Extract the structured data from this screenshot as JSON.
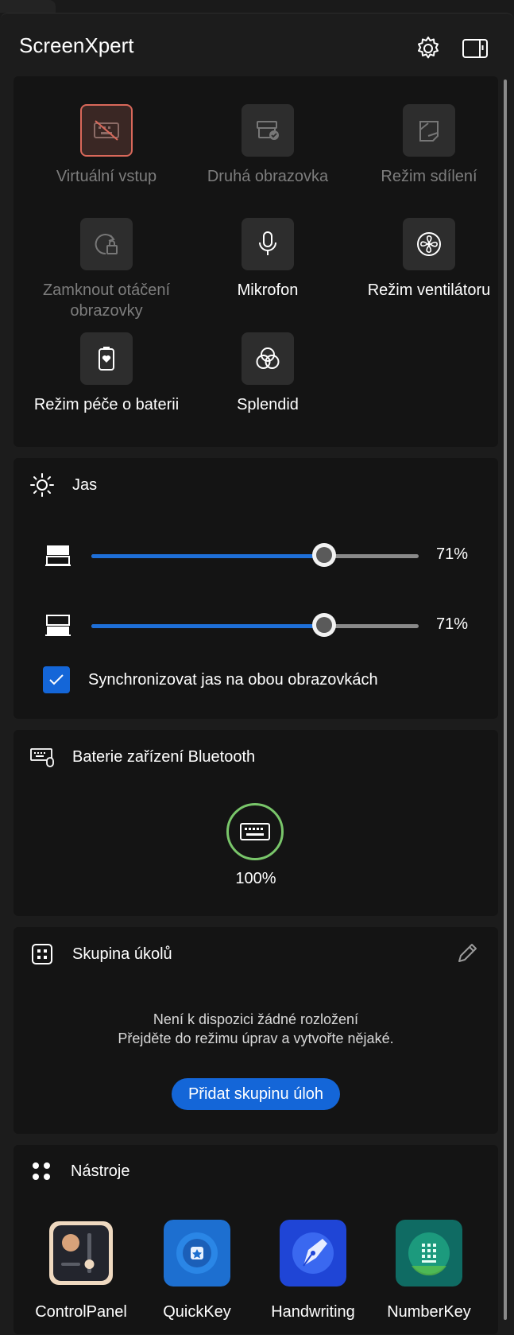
{
  "header": {
    "title": "ScreenXpert",
    "settings_icon": "gear-icon",
    "layout_icon": "panel-layout-icon"
  },
  "quick_tiles": [
    {
      "label": "Virtuální vstup",
      "icon": "keyboard-off-icon",
      "state": "active",
      "enabled": false
    },
    {
      "label": "Druhá obrazovka",
      "icon": "second-screen-icon",
      "enabled": false
    },
    {
      "label": "Režim sdílení",
      "icon": "share-mode-icon",
      "enabled": false
    },
    {
      "label": "Zamknout otáčení obrazovky",
      "icon": "rotation-lock-icon",
      "enabled": false
    },
    {
      "label": "Mikrofon",
      "icon": "microphone-icon",
      "enabled": true
    },
    {
      "label": "Režim ventilátoru",
      "icon": "fan-icon",
      "enabled": true
    },
    {
      "label": "Režim péče o baterii",
      "icon": "battery-care-icon",
      "enabled": true
    },
    {
      "label": "Splendid",
      "icon": "splendid-icon",
      "enabled": true
    }
  ],
  "brightness": {
    "title": "Jas",
    "icon": "sun-icon",
    "sliders": [
      {
        "screen": "top-screen-icon",
        "value": 71,
        "label": "71%"
      },
      {
        "screen": "bottom-screen-icon",
        "value": 71,
        "label": "71%"
      }
    ],
    "sync": {
      "label": "Synchronizovat jas na obou obrazovkách",
      "checked": true
    }
  },
  "bluetooth": {
    "title": "Baterie zařízení Bluetooth",
    "icon": "keyboard-mouse-icon",
    "device_icon": "keyboard-icon",
    "level": 100,
    "level_label": "100%"
  },
  "task_group": {
    "title": "Skupina úkolů",
    "icon": "task-grid-icon",
    "edit_icon": "pencil-icon",
    "empty_line1": "Není k dispozici žádné rozložení",
    "empty_line2": "Přejděte do režimu úprav a vytvořte nějaké.",
    "add_button": "Přidat skupinu úloh"
  },
  "tools": {
    "title": "Nástroje",
    "icon": "dots-grid-icon",
    "items": [
      {
        "label": "ControlPanel",
        "icon": "control-panel-icon"
      },
      {
        "label": "QuickKey",
        "icon": "quickkey-icon"
      },
      {
        "label": "Handwriting",
        "icon": "handwriting-pen-icon"
      },
      {
        "label": "NumberKey",
        "icon": "numberkey-icon"
      }
    ]
  },
  "colors": {
    "accent": "#1466d8",
    "battery_ring": "#79c66a",
    "active_tile_border": "#d9685a"
  }
}
